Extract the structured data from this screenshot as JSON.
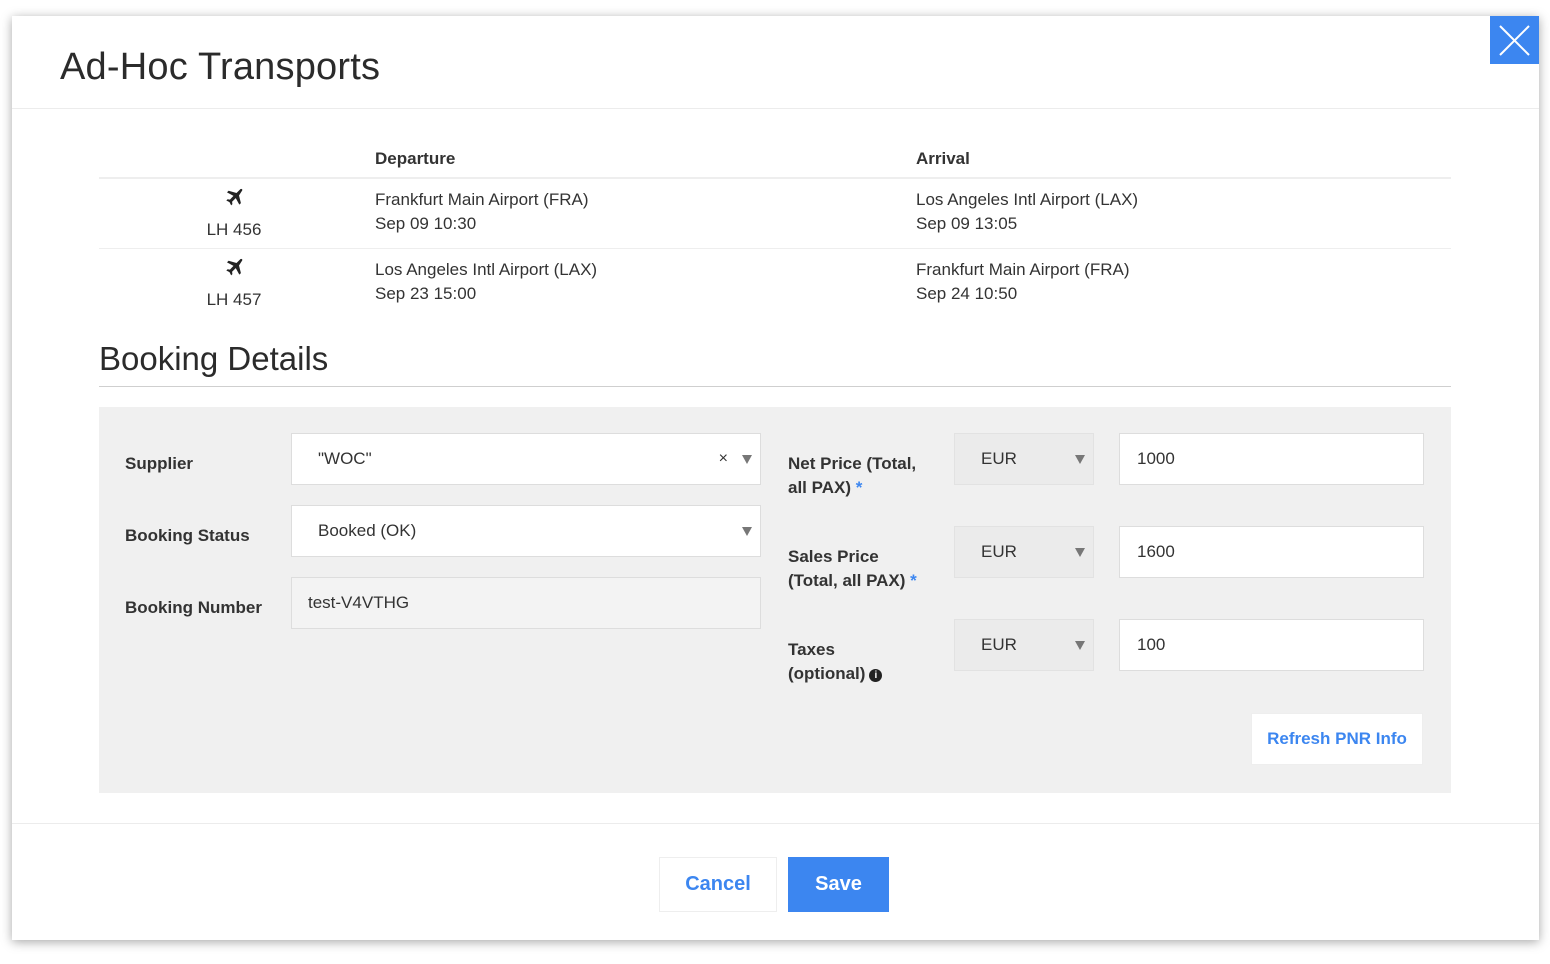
{
  "modal": {
    "title": "Ad-Hoc Transports",
    "close_icon": "close-icon",
    "accent_color": "#3c86f0"
  },
  "flights": {
    "headers": {
      "departure": "Departure",
      "arrival": "Arrival"
    },
    "icon": "airplane-icon",
    "rows": [
      {
        "code": "LH 456",
        "departure_place": "Frankfurt Main Airport (FRA)",
        "departure_time": "Sep 09 10:30",
        "arrival_place": "Los Angeles Intl Airport (LAX)",
        "arrival_time": "Sep 09 13:05"
      },
      {
        "code": "LH 457",
        "departure_place": "Los Angeles Intl Airport (LAX)",
        "departure_time": "Sep 23 15:00",
        "arrival_place": "Frankfurt Main Airport (FRA)",
        "arrival_time": "Sep 24 10:50"
      }
    ]
  },
  "booking": {
    "section_title": "Booking Details",
    "supplier": {
      "label": "Supplier",
      "value": "\"WOC\"",
      "clear": "×"
    },
    "status": {
      "label": "Booking Status",
      "value": "Booked (OK)"
    },
    "number": {
      "label": "Booking Number",
      "value": "test-V4VTHG"
    },
    "net_price": {
      "label_line1": "Net Price (Total,",
      "label_line2": "all PAX)",
      "required": "*",
      "currency": "EUR",
      "amount": "1000"
    },
    "sales_price": {
      "label_line1": "Sales Price",
      "label_line2": "(Total, all PAX)",
      "required": "*",
      "currency": "EUR",
      "amount": "1600"
    },
    "taxes": {
      "label_line1": "Taxes",
      "label_line2": "(optional)",
      "info_icon": "info-icon",
      "currency": "EUR",
      "amount": "100"
    },
    "refresh_label": "Refresh PNR Info"
  },
  "footer": {
    "cancel_label": "Cancel",
    "save_label": "Save"
  }
}
